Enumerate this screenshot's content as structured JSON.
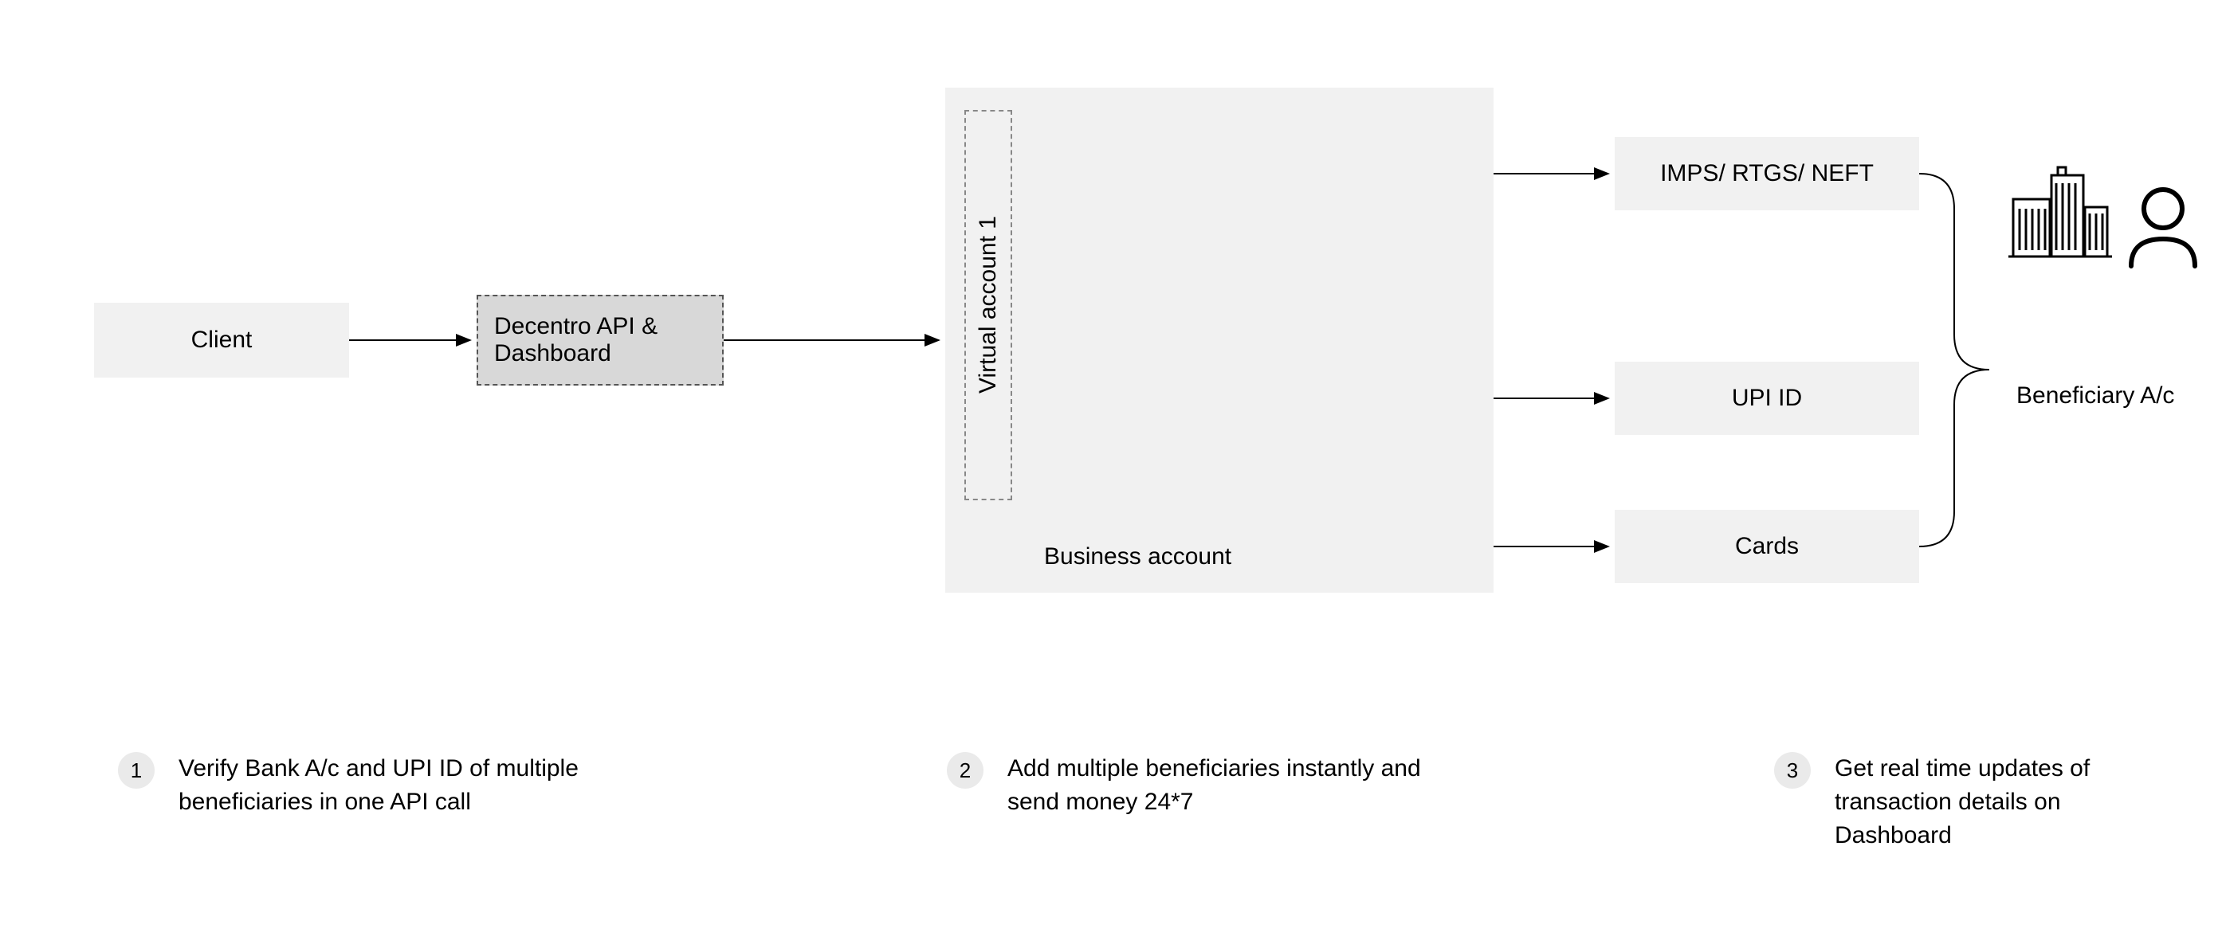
{
  "nodes": {
    "client": "Client",
    "decentro": "Decentro API & Dashboard",
    "virtual_account": "Virtual account 1",
    "business_account": "Business account",
    "payment_methods": {
      "bank": "IMPS/ RTGS/ NEFT",
      "upi": "UPI ID",
      "cards": "Cards"
    },
    "beneficiary": "Beneficiary A/c"
  },
  "steps": [
    {
      "num": "1",
      "text": "Verify Bank A/c and UPI ID of multiple beneficiaries in one API call"
    },
    {
      "num": "2",
      "text": "Add multiple beneficiaries instantly and send money 24*7"
    },
    {
      "num": "3",
      "text": "Get real time updates of transaction details on Dashboard"
    }
  ],
  "icons": {
    "building": "building-icon",
    "person": "person-icon"
  }
}
